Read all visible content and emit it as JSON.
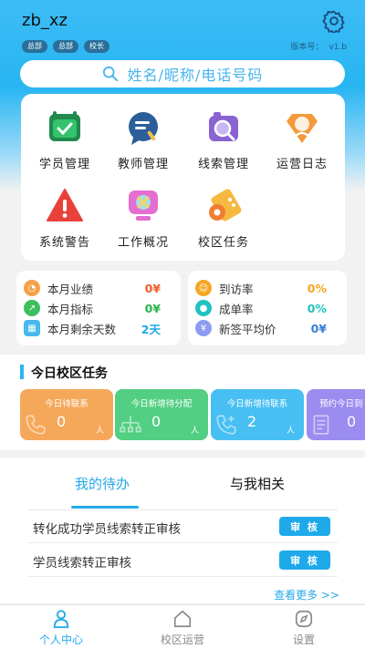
{
  "header": {
    "username": "zb_xz",
    "roles": [
      "总部",
      "总部",
      "校长"
    ],
    "version_label": "版本号：",
    "version_value": "v1.b"
  },
  "search": {
    "placeholder": "姓名/昵称/电话号码"
  },
  "grid": [
    {
      "label": "学员管理",
      "icon": "student-card-icon"
    },
    {
      "label": "教师管理",
      "icon": "teacher-chat-icon"
    },
    {
      "label": "线索管理",
      "icon": "clue-search-icon"
    },
    {
      "label": "运营日志",
      "icon": "log-badge-icon"
    },
    {
      "label": "系统警告",
      "icon": "warning-icon"
    },
    {
      "label": "工作概况",
      "icon": "work-monitor-icon"
    },
    {
      "label": "校区任务",
      "icon": "campus-task-icon"
    }
  ],
  "stats_left": [
    {
      "label": "本月业绩",
      "value": "0¥",
      "color": "#f15a24"
    },
    {
      "label": "本月指标",
      "value": "0¥",
      "color": "#2bb24c"
    },
    {
      "label": "本月剩余天数",
      "value": "2天",
      "color": "#1ea9ea"
    }
  ],
  "stats_right": [
    {
      "label": "到访率",
      "value": "0%",
      "color": "#f5a623"
    },
    {
      "label": "成单率",
      "value": "0%",
      "color": "#1fc3c0"
    },
    {
      "label": "新签平均价",
      "value": "0¥",
      "color": "#3a7bd5"
    }
  ],
  "tasks": {
    "title": "今日校区任务",
    "items": [
      {
        "title": "今日待联系",
        "value": "0",
        "unit": "人"
      },
      {
        "title": "今日新增待分配",
        "value": "0",
        "unit": "人"
      },
      {
        "title": "今日新增待联系",
        "value": "2",
        "unit": "人"
      },
      {
        "title": "预约今日到",
        "value": "0",
        "unit": ""
      }
    ]
  },
  "todo": {
    "tab_mine": "我的待办",
    "tab_related": "与我相关",
    "items": [
      {
        "text": "转化成功学员线索转正审核",
        "button": "审 核"
      },
      {
        "text": "学员线索转正审核",
        "button": "审 核"
      }
    ],
    "more": "查看更多 >>"
  },
  "nav": [
    {
      "label": "个人中心",
      "icon": "person-icon"
    },
    {
      "label": "校区运营",
      "icon": "home-icon"
    },
    {
      "label": "设置",
      "icon": "compass-icon"
    }
  ],
  "colors": {
    "accent": "#23a9ea"
  }
}
